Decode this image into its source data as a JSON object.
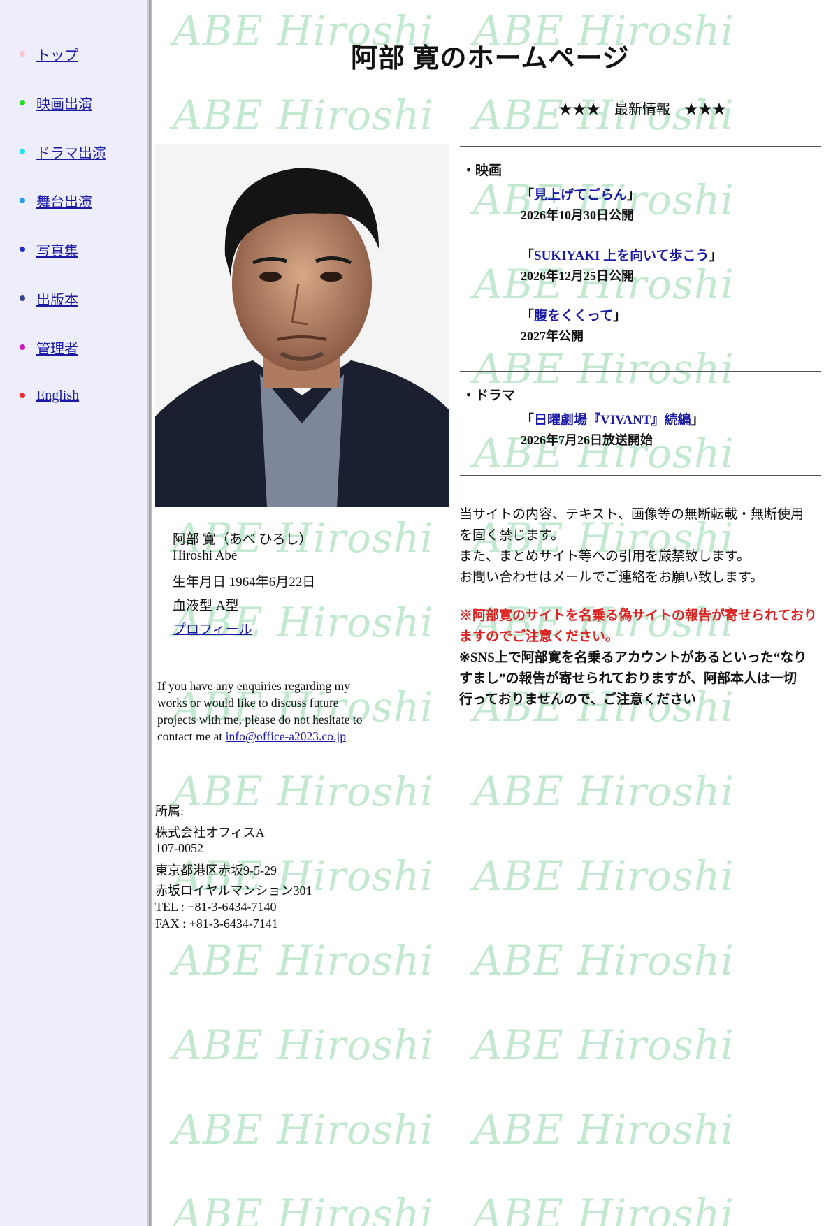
{
  "sidebar": {
    "items": [
      {
        "label": "トップ",
        "dot_color": "#f5c4cc"
      },
      {
        "label": "映画出演",
        "dot_color": "#22dd22"
      },
      {
        "label": "ドラマ出演",
        "dot_color": "#22e0e8"
      },
      {
        "label": "舞台出演",
        "dot_color": "#2a9cf0"
      },
      {
        "label": "写真集",
        "dot_color": "#1f2fd0"
      },
      {
        "label": "出版本",
        "dot_color": "#34408c"
      },
      {
        "label": "管理者",
        "dot_color": "#d019b8"
      },
      {
        "label": "English",
        "dot_color": "#ee2a2a"
      }
    ]
  },
  "watermark_text": "ABE Hiroshi",
  "page_title": "阿部 寛のホームページ",
  "news": {
    "heading": "★★★　最新情報　★★★",
    "movie_label": "・映画",
    "movies": [
      {
        "title": "見上げてごらん",
        "date": "2026年10月30日公開"
      },
      {
        "title": "SUKIYAKI 上を向いて歩こう",
        "date": "2026年12月25日公開"
      },
      {
        "title": "腹をくくって",
        "date": "2027年公開"
      }
    ],
    "drama_label": "・ドラマ",
    "dramas": [
      {
        "title": "日曜劇場『VIVANT』続編",
        "date": "2026年7月26日放送開始"
      }
    ],
    "open_quote": "「",
    "close_quote": "」"
  },
  "profile": {
    "name_ja": "阿部 寛（あべ ひろし）",
    "name_en": "Hiroshi Abe",
    "birthday": "生年月日 1964年6月22日",
    "blood_type": "血液型 A型",
    "profile_link": "プロフィール"
  },
  "contact": {
    "text": "If you have any enquiries regarding my works or would like to discuss future projects with me, please do not hesitate to contact me at ",
    "email": "info@office-a2023.co.jp"
  },
  "affiliation": {
    "label": "所属:",
    "lines": [
      "株式会社オフィスA",
      "107-0052",
      "東京都港区赤坂9-5-29",
      "赤坂ロイヤルマンション301",
      "TEL : +81-3-6434-7140",
      "FAX : +81-3-6434-7141"
    ]
  },
  "notice": {
    "copyright_lines": [
      "当サイトの内容、テキスト、画像等の無断転載・無断使用",
      "を固く禁じます。",
      "また、まとめサイト等への引用を厳禁致します。",
      "お問い合わせはメールでご連絡をお願い致します。"
    ],
    "warning_lines": [
      "※阿部寛のサイトを名乗る偽サイトの報告が寄せられており",
      "ますのでご注意ください。"
    ],
    "sns_lines": [
      "※SNS上で阿部寛を名乗るアカウントがあるといった“なり",
      "すまし”の報告が寄せられておりますが、阿部本人は一切",
      "行っておりませんので、ご注意ください"
    ]
  },
  "colors": {
    "sidebar_bg": "#ededfb",
    "link": "#1a1aa6",
    "warning": "#dd2222",
    "watermark": "#b8e6c8"
  }
}
